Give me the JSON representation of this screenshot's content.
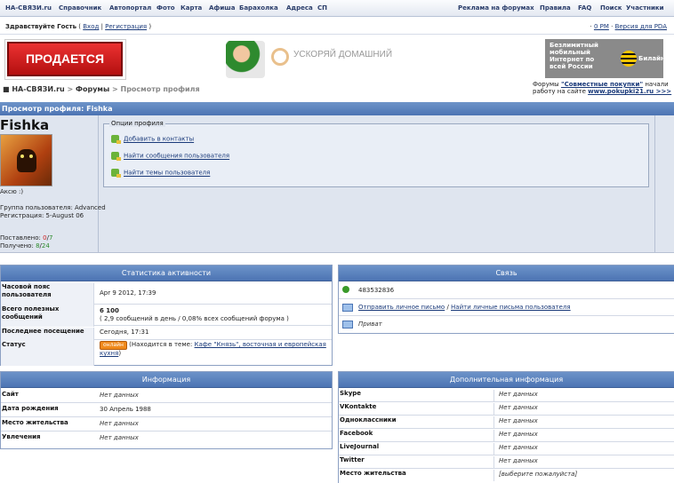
{
  "topnav": {
    "left": [
      "НА-СВЯЗИ.ru",
      "Справочник",
      "Автопортал",
      "Фото",
      "Карта",
      "Афиша",
      "Барахолка",
      "Адреса",
      "СП"
    ],
    "right": [
      "Реклама на форумах",
      "Правила",
      "FAQ",
      "Поиск",
      "Участники"
    ]
  },
  "welcome": {
    "greeting": "Здравствуйте Гость",
    "login": "Вход",
    "register": "Регистрация",
    "rss": "0 PM",
    "pda": "Версия для PDA"
  },
  "banners": {
    "sale": "ПРОДАЕТСЯ",
    "internet": "УСКОРЯЙ ДОМАШНИЙ",
    "beeline_text": "Безлимитный мобильный Интернет по всей России",
    "beeline_brand": "Билайн"
  },
  "breadcrumb": {
    "site": "НА-СВЯЗИ.ru",
    "forums": "Форумы",
    "current": "Просмотр профиля"
  },
  "forum_note": {
    "prefix": "Форумы ",
    "link1": "\"Совместные покупки\"",
    "middle": " начали работу на сайте ",
    "link2": "www.pokupki21.ru >>>"
  },
  "profile": {
    "bar_title": "Просмотр профиля: Fishka",
    "nickname": "Fishka",
    "status_text": "Аксю :)",
    "group": "Группа пользователя: Advanced",
    "registered": "Регистрация: 5-August 06",
    "given_label": "Поставлено: ",
    "given_a": "0",
    "given_sep": "/",
    "given_b": "7",
    "received_label": "Получено: ",
    "received_a": "8",
    "received_b": "24",
    "options_title": "Опции профиля",
    "options": [
      "Добавить в контакты",
      "Найти сообщения пользователя",
      "Найти темы пользователя"
    ]
  },
  "stats": {
    "header": "Статистика активности",
    "tz_label": "Часовой пояс пользователя",
    "tz_value": "Apr 9 2012, 17:39",
    "posts_label": "Всего полезных сообщений",
    "posts_value": "6 100",
    "posts_detail": "( 2,9 сообщений в день / 0,08% всех сообщений форума )",
    "last_label": "Последнее посещение",
    "last_value": "Сегодня, 17:31",
    "status_label": "Статус",
    "status_prefix": "(Находится в теме: ",
    "status_link": "Кафе \"Князь\", восточная и европейская кухня",
    "status_suffix": ")",
    "online_badge": "онлайн"
  },
  "contact": {
    "header": "Связь",
    "icq": "483532836",
    "send_pm": "Отправить личное письмо",
    "sep": " / ",
    "find_pm": "Найти личные письма пользователя",
    "private": "Приват"
  },
  "info": {
    "header": "Информация",
    "rows": [
      {
        "k": "Сайт",
        "v": "Нет данных"
      },
      {
        "k": "Дата рождения",
        "v": "30 Апрель 1988"
      },
      {
        "k": "Место жительства",
        "v": "Нет данных"
      },
      {
        "k": "Увлечения",
        "v": "Нет данных"
      }
    ]
  },
  "extra": {
    "header": "Дополнительная информация",
    "rows": [
      {
        "k": "Skype",
        "v": "Нет данных"
      },
      {
        "k": "VKontakte",
        "v": "Нет данных"
      },
      {
        "k": "Одноклассники",
        "v": "Нет данных"
      },
      {
        "k": "Facebook",
        "v": "Нет данных"
      },
      {
        "k": "LiveJournal",
        "v": "Нет данных"
      },
      {
        "k": "Twitter",
        "v": "Нет данных"
      },
      {
        "k": "Место жительства",
        "v": "[выберите пожалуйста]"
      }
    ]
  }
}
